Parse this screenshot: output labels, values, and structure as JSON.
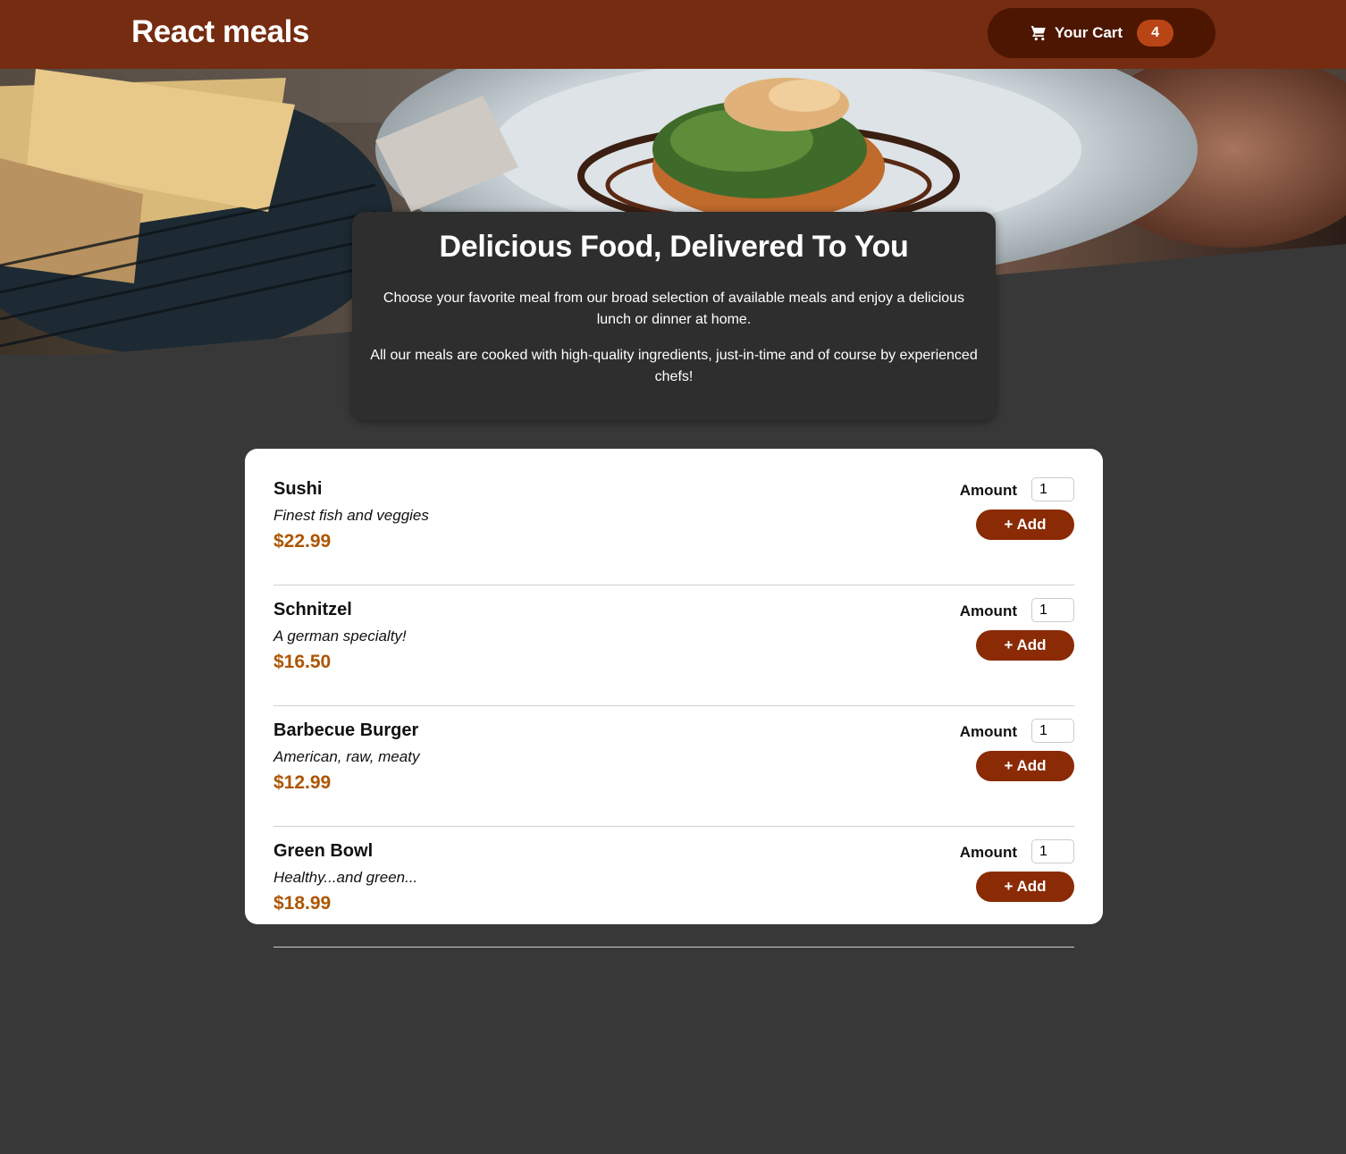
{
  "header": {
    "brand": "React meals",
    "cart": {
      "label": "Your Cart",
      "count": "4",
      "icon": "cart-icon"
    }
  },
  "colors": {
    "header_bg": "#752c11",
    "cart_bg": "#4d1601",
    "badge_bg": "#b94517",
    "button_bg": "#8a2b06",
    "price": "#ad5502",
    "page_bg": "#383838",
    "summary_bg": "#2e2e2e"
  },
  "summary": {
    "title": "Delicious Food, Delivered To You",
    "paragraph1": "Choose your favorite meal from our broad selection of available meals and enjoy a delicious lunch or dinner at home.",
    "paragraph2": "All our meals are cooked with high-quality ingredients, just-in-time and of course by experienced chefs!"
  },
  "meals": [
    {
      "name": "Sushi",
      "description": "Finest fish and veggies",
      "price": "$22.99",
      "amount_label": "Amount",
      "amount_value": "1",
      "add_label": "+ Add"
    },
    {
      "name": "Schnitzel",
      "description": "A german specialty!",
      "price": "$16.50",
      "amount_label": "Amount",
      "amount_value": "1",
      "add_label": "+ Add"
    },
    {
      "name": "Barbecue Burger",
      "description": "American, raw, meaty",
      "price": "$12.99",
      "amount_label": "Amount",
      "amount_value": "1",
      "add_label": "+ Add"
    },
    {
      "name": "Green Bowl",
      "description": "Healthy...and green...",
      "price": "$18.99",
      "amount_label": "Amount",
      "amount_value": "1",
      "add_label": "+ Add"
    }
  ]
}
